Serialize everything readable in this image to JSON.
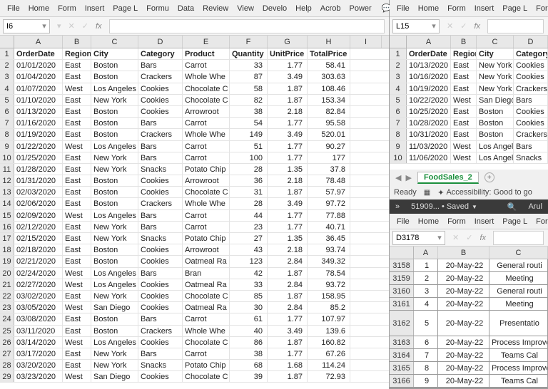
{
  "ribbons": {
    "left": [
      "File",
      "Home",
      "Form",
      "Insert",
      "Page L",
      "Formu",
      "Data",
      "Review",
      "View",
      "Develo",
      "Help",
      "Acrob",
      "Power"
    ],
    "right_top": [
      "File",
      "Home",
      "Form",
      "Insert",
      "Page L",
      "Formu"
    ],
    "right_bottom": [
      "File",
      "Home",
      "Form",
      "Insert",
      "Page L",
      "Formu"
    ]
  },
  "namebox_left": "I6",
  "namebox_right_top": "L15",
  "namebox_right_bottom": "D3178",
  "fx_label": "fx",
  "sheet_tab_name": "FoodSales_2",
  "status": {
    "ready": "Ready",
    "access": "Accessibility: Good to go"
  },
  "title_right": {
    "name": "51909... • Saved",
    "user": "Arul"
  },
  "more_label": "»",
  "left_cols": [
    "A",
    "B",
    "C",
    "D",
    "E",
    "F",
    "G",
    "H",
    "I"
  ],
  "left_headers": [
    "OrderDate",
    "Region",
    "City",
    "Category",
    "Product",
    "Quantity",
    "UnitPrice",
    "TotalPrice"
  ],
  "left_data": [
    [
      "01/01/2020",
      "East",
      "Boston",
      "Bars",
      "Carrot",
      "33",
      "1.77",
      "58.41"
    ],
    [
      "01/04/2020",
      "East",
      "Boston",
      "Crackers",
      "Whole Whe",
      "87",
      "3.49",
      "303.63"
    ],
    [
      "01/07/2020",
      "West",
      "Los Angeles",
      "Cookies",
      "Chocolate C",
      "58",
      "1.87",
      "108.46"
    ],
    [
      "01/10/2020",
      "East",
      "New York",
      "Cookies",
      "Chocolate C",
      "82",
      "1.87",
      "153.34"
    ],
    [
      "01/13/2020",
      "East",
      "Boston",
      "Cookies",
      "Arrowroot",
      "38",
      "2.18",
      "82.84"
    ],
    [
      "01/16/2020",
      "East",
      "Boston",
      "Bars",
      "Carrot",
      "54",
      "1.77",
      "95.58"
    ],
    [
      "01/19/2020",
      "East",
      "Boston",
      "Crackers",
      "Whole Whe",
      "149",
      "3.49",
      "520.01"
    ],
    [
      "01/22/2020",
      "West",
      "Los Angeles",
      "Bars",
      "Carrot",
      "51",
      "1.77",
      "90.27"
    ],
    [
      "01/25/2020",
      "East",
      "New York",
      "Bars",
      "Carrot",
      "100",
      "1.77",
      "177"
    ],
    [
      "01/28/2020",
      "East",
      "New York",
      "Snacks",
      "Potato Chip",
      "28",
      "1.35",
      "37.8"
    ],
    [
      "01/31/2020",
      "East",
      "Boston",
      "Cookies",
      "Arrowroot",
      "36",
      "2.18",
      "78.48"
    ],
    [
      "02/03/2020",
      "East",
      "Boston",
      "Cookies",
      "Chocolate C",
      "31",
      "1.87",
      "57.97"
    ],
    [
      "02/06/2020",
      "East",
      "Boston",
      "Crackers",
      "Whole Whe",
      "28",
      "3.49",
      "97.72"
    ],
    [
      "02/09/2020",
      "West",
      "Los Angeles",
      "Bars",
      "Carrot",
      "44",
      "1.77",
      "77.88"
    ],
    [
      "02/12/2020",
      "East",
      "New York",
      "Bars",
      "Carrot",
      "23",
      "1.77",
      "40.71"
    ],
    [
      "02/15/2020",
      "East",
      "New York",
      "Snacks",
      "Potato Chip",
      "27",
      "1.35",
      "36.45"
    ],
    [
      "02/18/2020",
      "East",
      "Boston",
      "Cookies",
      "Arrowroot",
      "43",
      "2.18",
      "93.74"
    ],
    [
      "02/21/2020",
      "East",
      "Boston",
      "Cookies",
      "Oatmeal Ra",
      "123",
      "2.84",
      "349.32"
    ],
    [
      "02/24/2020",
      "West",
      "Los Angeles",
      "Bars",
      "Bran",
      "42",
      "1.87",
      "78.54"
    ],
    [
      "02/27/2020",
      "West",
      "Los Angeles",
      "Cookies",
      "Oatmeal Ra",
      "33",
      "2.84",
      "93.72"
    ],
    [
      "03/02/2020",
      "East",
      "New York",
      "Cookies",
      "Chocolate C",
      "85",
      "1.87",
      "158.95"
    ],
    [
      "03/05/2020",
      "West",
      "San Diego",
      "Cookies",
      "Oatmeal Ra",
      "30",
      "2.84",
      "85.2"
    ],
    [
      "03/08/2020",
      "East",
      "Boston",
      "Bars",
      "Carrot",
      "61",
      "1.77",
      "107.97"
    ],
    [
      "03/11/2020",
      "East",
      "Boston",
      "Crackers",
      "Whole Whe",
      "40",
      "3.49",
      "139.6"
    ],
    [
      "03/14/2020",
      "West",
      "Los Angeles",
      "Cookies",
      "Chocolate C",
      "86",
      "1.87",
      "160.82"
    ],
    [
      "03/17/2020",
      "East",
      "New York",
      "Bars",
      "Carrot",
      "38",
      "1.77",
      "67.26"
    ],
    [
      "03/20/2020",
      "East",
      "New York",
      "Snacks",
      "Potato Chip",
      "68",
      "1.68",
      "114.24"
    ],
    [
      "03/23/2020",
      "West",
      "San Diego",
      "Cookies",
      "Chocolate C",
      "39",
      "1.87",
      "72.93"
    ]
  ],
  "right_top_cols": [
    "A",
    "B",
    "C",
    "D"
  ],
  "right_top_headers": [
    "OrderDate",
    "Region",
    "City",
    "Category"
  ],
  "right_top_data": [
    [
      "10/13/2020",
      "East",
      "New York",
      "Cookies"
    ],
    [
      "10/16/2020",
      "East",
      "New York",
      "Cookies"
    ],
    [
      "10/19/2020",
      "East",
      "New York",
      "Crackers"
    ],
    [
      "10/22/2020",
      "West",
      "San Diego",
      "Bars"
    ],
    [
      "10/25/2020",
      "East",
      "Boston",
      "Cookies"
    ],
    [
      "10/28/2020",
      "East",
      "Boston",
      "Cookies"
    ],
    [
      "10/31/2020",
      "East",
      "Boston",
      "Crackers"
    ],
    [
      "11/03/2020",
      "West",
      "Los Angel",
      "Bars"
    ],
    [
      "11/06/2020",
      "West",
      "Los Angel",
      "Snacks"
    ]
  ],
  "right_bottom_cols": [
    "A",
    "B",
    "C"
  ],
  "right_bottom_data": [
    {
      "rn": "3158",
      "a": "1",
      "b": "20-May-22",
      "c": "General routi"
    },
    {
      "rn": "3159",
      "a": "2",
      "b": "20-May-22",
      "c": "Meeting"
    },
    {
      "rn": "3160",
      "a": "3",
      "b": "20-May-22",
      "c": "General routi"
    },
    {
      "rn": "3161",
      "a": "4",
      "b": "20-May-22",
      "c": "Meeting"
    },
    {
      "rn": "3162",
      "a": "5",
      "b": "20-May-22",
      "c": "Presentatio",
      "tall": true
    },
    {
      "rn": "3163",
      "a": "6",
      "b": "20-May-22",
      "c": "Process Improve"
    },
    {
      "rn": "3164",
      "a": "7",
      "b": "20-May-22",
      "c": "Teams Cal"
    },
    {
      "rn": "3165",
      "a": "8",
      "b": "20-May-22",
      "c": "Process Improve"
    },
    {
      "rn": "3166",
      "a": "9",
      "b": "20-May-22",
      "c": "Teams Cal"
    }
  ]
}
